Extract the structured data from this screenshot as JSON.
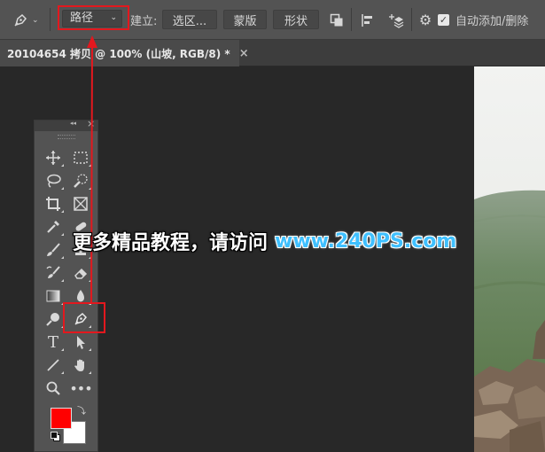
{
  "options_bar": {
    "path_mode": "路径",
    "make_label": "建立:",
    "selection_button": "选区...",
    "mask_button": "蒙版",
    "shape_button": "形状",
    "auto_add_delete": "自动添加/删除",
    "auto_add_delete_checked": true
  },
  "document_tab": {
    "title": "20104654 拷贝 @ 100% (山坡, RGB/8) *",
    "close_glyph": "×"
  },
  "tools_panel": {
    "collapse_glyph": "◂◂",
    "close_glyph": "×"
  },
  "watermark": {
    "chinese_text": "更多精品教程，请访问",
    "url_text": "www.240PS.com"
  },
  "colors": {
    "foreground": "#ff0000",
    "background": "#ffffff",
    "annotation_red": "#e3181e",
    "watermark_url": "#3fc0ff"
  }
}
